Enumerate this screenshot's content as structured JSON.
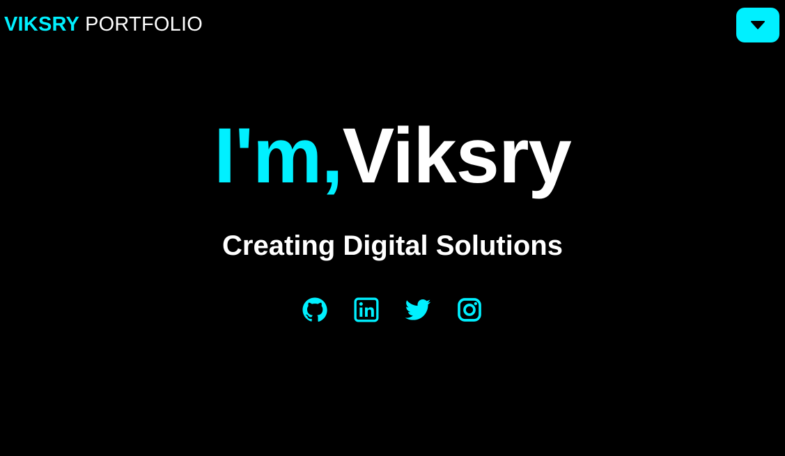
{
  "header": {
    "brand_name": "VIKSRY",
    "brand_suffix": "PORTFOLIO",
    "menu_toggle_icon": "caret-down-icon"
  },
  "hero": {
    "greeting": "I'm,",
    "name": "Viksry",
    "tagline": "Creating Digital Solutions"
  },
  "social_links": [
    {
      "icon": "github-icon"
    },
    {
      "icon": "linkedin-icon"
    },
    {
      "icon": "twitter-icon"
    },
    {
      "icon": "instagram-icon"
    }
  ],
  "colors": {
    "accent": "#00f0ff",
    "background": "#000000",
    "text": "#ffffff"
  }
}
